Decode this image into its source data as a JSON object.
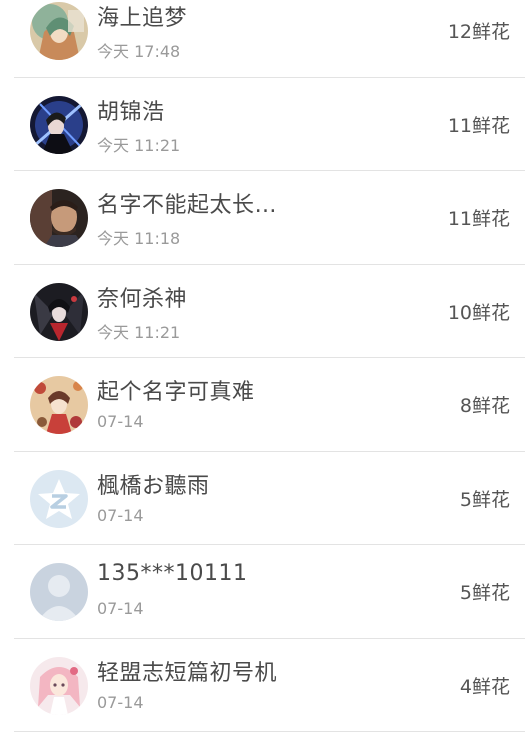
{
  "ranking": {
    "rows": [
      {
        "name": "海上追梦",
        "time": "今天 17:48",
        "flowers": "12鲜花",
        "avatar": "anime-girl-green-avatar"
      },
      {
        "name": "胡锦浩",
        "time": "今天 11:21",
        "flowers": "11鲜花",
        "avatar": "anime-swordsman-blue-avatar"
      },
      {
        "name": "名字不能起太长…",
        "time": "今天 11:18",
        "flowers": "11鲜花",
        "avatar": "man-portrait-avatar"
      },
      {
        "name": "奈何杀神",
        "time": "今天 11:21",
        "flowers": "10鲜花",
        "avatar": "dark-anime-avatar"
      },
      {
        "name": "起个名字可真难",
        "time": "07-14",
        "flowers": "8鲜花",
        "avatar": "anime-girl-floral-avatar"
      },
      {
        "name": "楓橋お聽雨",
        "time": "07-14",
        "flowers": "5鲜花",
        "avatar": "qzone-star-default-avatar"
      },
      {
        "name": "135***10111",
        "time": "07-14",
        "flowers": "5鲜花",
        "avatar": "default-person-avatar"
      },
      {
        "name": "轻盟志短篇初号机",
        "time": "07-14",
        "flowers": "4鲜花",
        "avatar": "anime-girl-pink-avatar"
      }
    ]
  },
  "colors": {
    "divider": "#e3e3e3",
    "name_text": "#4a4a4a",
    "time_text": "#9a9a9a",
    "flowers_text": "#555555"
  }
}
